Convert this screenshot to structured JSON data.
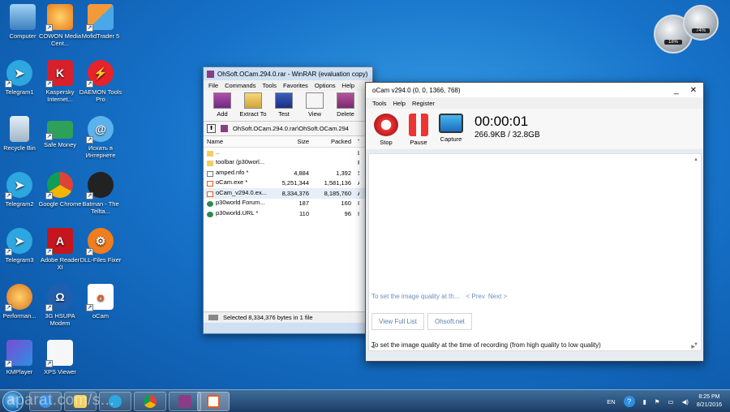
{
  "desktop": {
    "icons": [
      {
        "label": "Computer"
      },
      {
        "label": "COWON Media Cent..."
      },
      {
        "label": "MofidTrader 5"
      },
      {
        "label": "Telegram1"
      },
      {
        "label": "Kaspersky Internet..."
      },
      {
        "label": "DAEMON Tools Pro"
      },
      {
        "label": "Recycle Bin"
      },
      {
        "label": "Safe Money"
      },
      {
        "label": "Искать в Интернете"
      },
      {
        "label": "Telegram2"
      },
      {
        "label": "Google Chrome"
      },
      {
        "label": "Batman - The Tellta..."
      },
      {
        "label": "Telegram3"
      },
      {
        "label": "Adobe Reader XI"
      },
      {
        "label": "DLL-Files Fixer"
      },
      {
        "label": "Performan..."
      },
      {
        "label": "3G HSUPA Modem"
      },
      {
        "label": "oCam"
      },
      {
        "label": "KMPlayer"
      },
      {
        "label": "XPS Viewer"
      }
    ],
    "gadget": {
      "cpu": "18%",
      "mem": "74%"
    }
  },
  "winrar": {
    "title": "OhSoft.OCam.294.0.rar - WinRAR (evaluation copy)",
    "menu": [
      "File",
      "Commands",
      "Tools",
      "Favorites",
      "Options",
      "Help"
    ],
    "toolbar": [
      "Add",
      "Extract To",
      "Test",
      "View",
      "Delete"
    ],
    "path": "OhSoft.OCam.294.0.rar\\OhSoft.OCam.294",
    "columns": {
      "name": "Name",
      "size": "Size",
      "packed": "Packed",
      "type": "T"
    },
    "files": [
      {
        "name": "..",
        "size": "",
        "packed": "",
        "type": "L"
      },
      {
        "name": "toolbar (p30worl...",
        "size": "",
        "packed": "",
        "type": "F"
      },
      {
        "name": "amped.nfo *",
        "size": "4,884",
        "packed": "1,392",
        "type": "S"
      },
      {
        "name": "oCam.exe *",
        "size": "5,251,344",
        "packed": "1,581,136",
        "type": "A"
      },
      {
        "name": "oCam_v294.0.ex...",
        "size": "8,334,376",
        "packed": "8,185,760",
        "type": "A"
      },
      {
        "name": "p30world Forum...",
        "size": "187",
        "packed": "160",
        "type": "I"
      },
      {
        "name": "p30world.URL *",
        "size": "110",
        "packed": "96",
        "type": "I"
      }
    ],
    "status": "Selected 8,334,376 bytes in 1 file"
  },
  "ocam": {
    "title": "oCam v294.0 (0, 0, 1366, 768)",
    "menu": [
      "Tools",
      "Help",
      "Register"
    ],
    "buttons": [
      "Stop",
      "Pause",
      "Capture"
    ],
    "time": "00:00:01",
    "size": "266.9KB / 32.8GB",
    "tip": "To set the image quality at th...",
    "prev": "< Prev",
    "next": "Next >",
    "full_list": "View Full List",
    "site": "Ohsoft.net",
    "bottom": "To set the image quality at the time of recording (from high quality to low quality)"
  },
  "taskbar": {
    "lang": "EN",
    "time": "8:25 PM",
    "date": "8/21/2016"
  },
  "watermark": "aparat.com/s..."
}
